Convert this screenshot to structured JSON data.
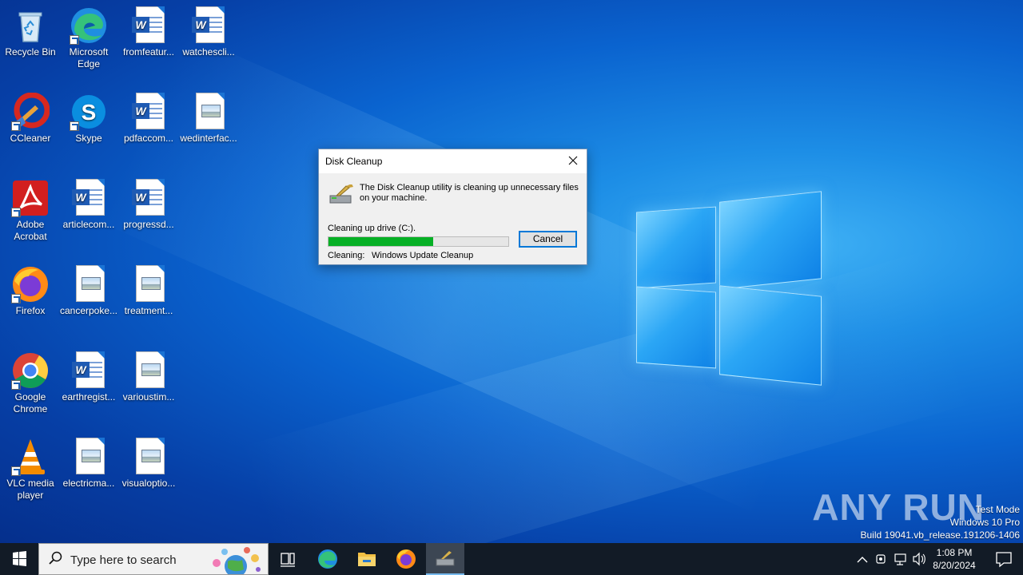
{
  "desktop": {
    "icons": [
      {
        "label": "Recycle Bin"
      },
      {
        "label": "Microsoft Edge"
      },
      {
        "label": "fromfeatur..."
      },
      {
        "label": "watchescli..."
      },
      {
        "label": "CCleaner"
      },
      {
        "label": "Skype"
      },
      {
        "label": "pdfaccom..."
      },
      {
        "label": "wedinterfac..."
      },
      {
        "label": "Adobe Acrobat"
      },
      {
        "label": "articlecom..."
      },
      {
        "label": "progressd..."
      },
      {
        "label": "Firefox"
      },
      {
        "label": "cancerpoke..."
      },
      {
        "label": "treatment..."
      },
      {
        "label": "Google Chrome"
      },
      {
        "label": "earthregist..."
      },
      {
        "label": "varioustim..."
      },
      {
        "label": "VLC media player"
      },
      {
        "label": "electricma..."
      },
      {
        "label": "visualoptio..."
      }
    ]
  },
  "dialog": {
    "title": "Disk Cleanup",
    "message": "The Disk Cleanup utility is cleaning up unnecessary files on your machine.",
    "drive_label": "Cleaning up drive  (C:).",
    "progress": 0.58,
    "cancel_label": "Cancel",
    "cleaning_label": "Cleaning:",
    "cleaning_value": "Windows Update Cleanup",
    "progress_color": "#06b025",
    "accent_color": "#0078d7"
  },
  "watermark": {
    "text": "ANY RUN",
    "line1": "Test Mode",
    "line2": "Windows 10 Pro",
    "line3": "Build 19041.vb_release.191206-1406"
  },
  "taskbar": {
    "search_placeholder": "Type here to search",
    "pinned": [
      "task-view",
      "edge",
      "file-explorer",
      "firefox",
      "disk-cleanup"
    ],
    "clock_time": "1:08 PM",
    "clock_date": "8/20/2024"
  }
}
